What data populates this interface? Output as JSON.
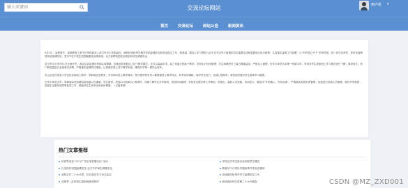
{
  "header": {
    "search_placeholder": "输入关键词",
    "site_title": "交流论坛网站",
    "username": "用户名"
  },
  "nav": [
    {
      "label": "首页"
    },
    {
      "label": "交流论坛"
    },
    {
      "label": "网站公告"
    },
    {
      "label": "新闻资讯"
    }
  ],
  "article": {
    "paragraphs": [
      "9月1日，省教育厅，省委教育工委书记李和城深入武汉市中小学和高校，调研检查秋季学期开学和疫情防控和安全稳定工作。他强调，要深入学习贯彻习近平总书记关于疫情防控的重要论述和重要指示批示精神，认真落实省委工作部署，以“时时放心不下”的责任感，进一步压实责任，抓好全省教育系统疫情防控，坚决守住不发生校园聚集性疫情底线，全力保障校园安全稳定和师生健康安全。",
      "武汉市中小学9月1日全面开学，各区结合疫情形势和区域需要，因地因校采取线上线下教学模式。在洪山高级中学，高三年级正陆续下教学，学校实行封闭管理，学生和教职员工每日健康监测，严格出入管理。在华中师范大学第一附属中学，学校对学生居家线上学习情况进行了解，要求家长、校门和校园进行全面清洁消毒，严格落实疫情防控措施，认真做好线上线下教学衔接，确保开学第一课安全有序。",
      "洪山区街办英语小学全校实施线上教学，李和城走进教室，关切询问线上教学情况。他叮嘱学校负责人要根据线上教学特点，科学安排课程，保护学生视力，加强心理疏导，家校协同做好学生居家学习管理。",
      "在华中师范大学，李和城实地查看智能测温入校通道、学生食堂、校园110指挥中心等场所，详细了解学生开学报到、校园封闭管理、学校安全稳定等工作情况。他指出，高校人员密集、流动性大，要坚持“外防输入、内防反弹”，严格落实校园封闭管理，加强进出校园人员管理，做好开学报到、校园生活服务保障等各项工作，确保师生生命安全和身体健康。（记者李畅）"
    ]
  },
  "hot": {
    "title": "热门文章推荐",
    "items": [
      {
        "text": "校领导参加“2022广东区域发展论坛”活动",
        "date": ""
      },
      {
        "text": "学校召开学生座谈会听取意见建议",
        "date": ""
      },
      {
        "text": "扎实抓好校园疫情防控 全力守护师生健康安全",
        "date": ""
      },
      {
        "text": "教育厅厅长带队开展秋季开学检查调研",
        "date": ""
      },
      {
        "text": "我校召开二十大代表、校长报告学习传达会议",
        "date": ""
      },
      {
        "text": "持续做好秋季开学与疫情防控工作",
        "date": ""
      },
      {
        "text": "迎新季 | 这份新生报到指南请收好",
        "date": ""
      },
      {
        "text": "我校组织师生收看二十大开幕会",
        "date": ""
      }
    ]
  },
  "watermark": "CSDN @MZ_ZXD001",
  "colors": {
    "primary": "#5a8fd1",
    "background": "#eef1f5"
  }
}
